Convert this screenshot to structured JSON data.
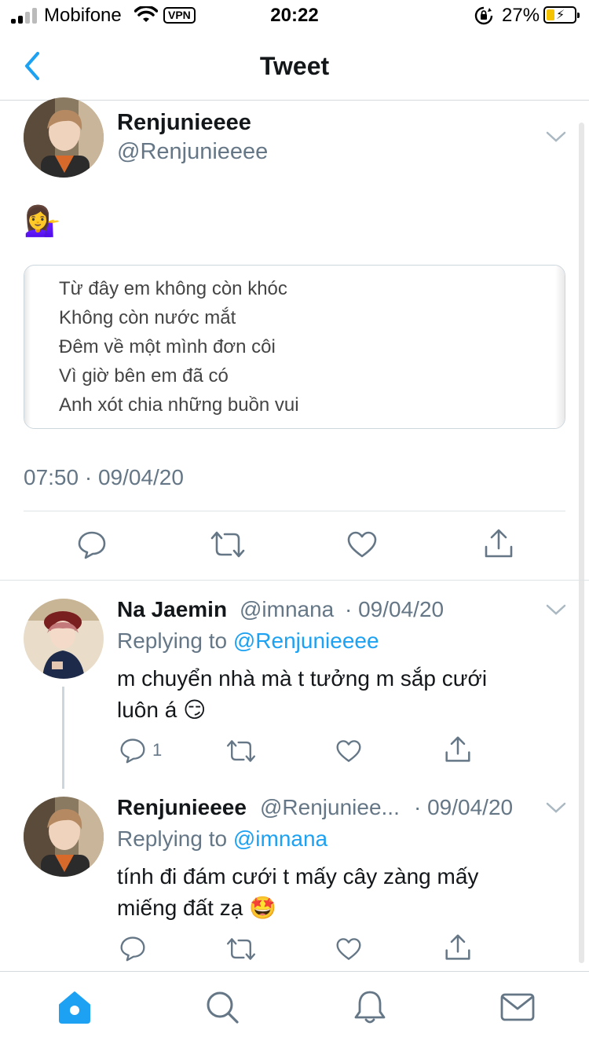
{
  "status_bar": {
    "carrier": "Mobifone",
    "vpn": "VPN",
    "time": "20:22",
    "battery_percent": "27%",
    "battery_color": "#f5c300"
  },
  "nav": {
    "title": "Tweet",
    "back_icon": "chevron-left-icon",
    "accent_color": "#1da1f2"
  },
  "main_tweet": {
    "author_name": "Renjunieeee",
    "handle": "@Renjunieeee",
    "emoji": "💁‍♀️",
    "quote_lines": [
      "Từ đây em không còn khóc",
      "Không còn nước mắt",
      "Đêm về một mình đơn côi",
      "Vì giờ bên em đã có",
      "Anh xót chia những buồn vui"
    ],
    "timestamp": "07:50 · 09/04/20"
  },
  "replies": [
    {
      "author_name": "Na Jaemin",
      "handle": "@imnana",
      "date": "· 09/04/20",
      "replying_prefix": "Replying to",
      "replying_to": "@Renjunieeee",
      "text_line1": "m chuyển nhà mà t tưởng m sắp cưới",
      "text_line2": "luôn á 😏",
      "reply_count": "1"
    },
    {
      "author_name": "Renjunieeee",
      "handle": "@Renjuniee...",
      "date": "· 09/04/20",
      "replying_prefix": "Replying to",
      "replying_to": "@imnana",
      "text_line1": "tính đi đám cưới t mấy cây zàng mấy",
      "text_line2": "miếng đất zạ 🤩",
      "reply_count": ""
    }
  ],
  "tab_bar": [
    "home-icon",
    "search-icon",
    "notifications-icon",
    "messages-icon"
  ]
}
